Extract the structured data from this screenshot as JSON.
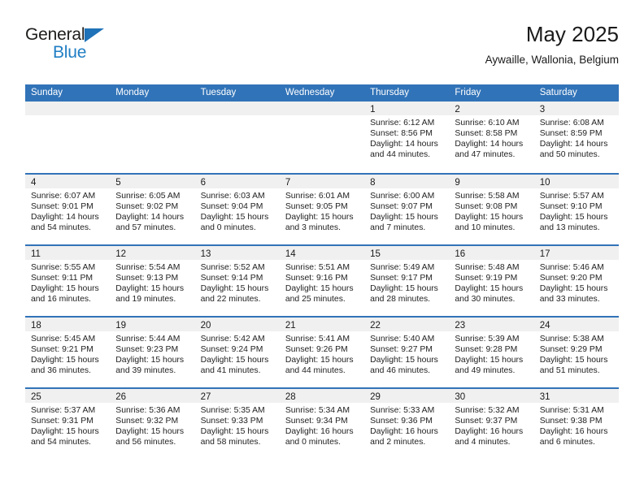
{
  "brand": {
    "name_part1": "General",
    "name_part2": "Blue",
    "triangle_color": "#1f72b8",
    "text_color_part2": "#1f7ec4"
  },
  "header": {
    "title": "May 2025",
    "subtitle": "Aywaille, Wallonia, Belgium"
  },
  "theme": {
    "header_blue": "#3173b8",
    "daystrip_gray": "#f0f0f0",
    "separator_blue": "#3173b8"
  },
  "weekday_headers": [
    "Sunday",
    "Monday",
    "Tuesday",
    "Wednesday",
    "Thursday",
    "Friday",
    "Saturday"
  ],
  "weeks": [
    {
      "days": [
        {
          "date": "",
          "empty": true,
          "sunrise": "",
          "sunset": "",
          "daylight_line1": "",
          "daylight_line2": ""
        },
        {
          "date": "",
          "empty": true,
          "sunrise": "",
          "sunset": "",
          "daylight_line1": "",
          "daylight_line2": ""
        },
        {
          "date": "",
          "empty": true,
          "sunrise": "",
          "sunset": "",
          "daylight_line1": "",
          "daylight_line2": ""
        },
        {
          "date": "",
          "empty": true,
          "sunrise": "",
          "sunset": "",
          "daylight_line1": "",
          "daylight_line2": ""
        },
        {
          "date": "1",
          "empty": false,
          "sunrise": "Sunrise: 6:12 AM",
          "sunset": "Sunset: 8:56 PM",
          "daylight_line1": "Daylight: 14 hours",
          "daylight_line2": "and 44 minutes."
        },
        {
          "date": "2",
          "empty": false,
          "sunrise": "Sunrise: 6:10 AM",
          "sunset": "Sunset: 8:58 PM",
          "daylight_line1": "Daylight: 14 hours",
          "daylight_line2": "and 47 minutes."
        },
        {
          "date": "3",
          "empty": false,
          "sunrise": "Sunrise: 6:08 AM",
          "sunset": "Sunset: 8:59 PM",
          "daylight_line1": "Daylight: 14 hours",
          "daylight_line2": "and 50 minutes."
        }
      ]
    },
    {
      "days": [
        {
          "date": "4",
          "empty": false,
          "sunrise": "Sunrise: 6:07 AM",
          "sunset": "Sunset: 9:01 PM",
          "daylight_line1": "Daylight: 14 hours",
          "daylight_line2": "and 54 minutes."
        },
        {
          "date": "5",
          "empty": false,
          "sunrise": "Sunrise: 6:05 AM",
          "sunset": "Sunset: 9:02 PM",
          "daylight_line1": "Daylight: 14 hours",
          "daylight_line2": "and 57 minutes."
        },
        {
          "date": "6",
          "empty": false,
          "sunrise": "Sunrise: 6:03 AM",
          "sunset": "Sunset: 9:04 PM",
          "daylight_line1": "Daylight: 15 hours",
          "daylight_line2": "and 0 minutes."
        },
        {
          "date": "7",
          "empty": false,
          "sunrise": "Sunrise: 6:01 AM",
          "sunset": "Sunset: 9:05 PM",
          "daylight_line1": "Daylight: 15 hours",
          "daylight_line2": "and 3 minutes."
        },
        {
          "date": "8",
          "empty": false,
          "sunrise": "Sunrise: 6:00 AM",
          "sunset": "Sunset: 9:07 PM",
          "daylight_line1": "Daylight: 15 hours",
          "daylight_line2": "and 7 minutes."
        },
        {
          "date": "9",
          "empty": false,
          "sunrise": "Sunrise: 5:58 AM",
          "sunset": "Sunset: 9:08 PM",
          "daylight_line1": "Daylight: 15 hours",
          "daylight_line2": "and 10 minutes."
        },
        {
          "date": "10",
          "empty": false,
          "sunrise": "Sunrise: 5:57 AM",
          "sunset": "Sunset: 9:10 PM",
          "daylight_line1": "Daylight: 15 hours",
          "daylight_line2": "and 13 minutes."
        }
      ]
    },
    {
      "days": [
        {
          "date": "11",
          "empty": false,
          "sunrise": "Sunrise: 5:55 AM",
          "sunset": "Sunset: 9:11 PM",
          "daylight_line1": "Daylight: 15 hours",
          "daylight_line2": "and 16 minutes."
        },
        {
          "date": "12",
          "empty": false,
          "sunrise": "Sunrise: 5:54 AM",
          "sunset": "Sunset: 9:13 PM",
          "daylight_line1": "Daylight: 15 hours",
          "daylight_line2": "and 19 minutes."
        },
        {
          "date": "13",
          "empty": false,
          "sunrise": "Sunrise: 5:52 AM",
          "sunset": "Sunset: 9:14 PM",
          "daylight_line1": "Daylight: 15 hours",
          "daylight_line2": "and 22 minutes."
        },
        {
          "date": "14",
          "empty": false,
          "sunrise": "Sunrise: 5:51 AM",
          "sunset": "Sunset: 9:16 PM",
          "daylight_line1": "Daylight: 15 hours",
          "daylight_line2": "and 25 minutes."
        },
        {
          "date": "15",
          "empty": false,
          "sunrise": "Sunrise: 5:49 AM",
          "sunset": "Sunset: 9:17 PM",
          "daylight_line1": "Daylight: 15 hours",
          "daylight_line2": "and 28 minutes."
        },
        {
          "date": "16",
          "empty": false,
          "sunrise": "Sunrise: 5:48 AM",
          "sunset": "Sunset: 9:19 PM",
          "daylight_line1": "Daylight: 15 hours",
          "daylight_line2": "and 30 minutes."
        },
        {
          "date": "17",
          "empty": false,
          "sunrise": "Sunrise: 5:46 AM",
          "sunset": "Sunset: 9:20 PM",
          "daylight_line1": "Daylight: 15 hours",
          "daylight_line2": "and 33 minutes."
        }
      ]
    },
    {
      "days": [
        {
          "date": "18",
          "empty": false,
          "sunrise": "Sunrise: 5:45 AM",
          "sunset": "Sunset: 9:21 PM",
          "daylight_line1": "Daylight: 15 hours",
          "daylight_line2": "and 36 minutes."
        },
        {
          "date": "19",
          "empty": false,
          "sunrise": "Sunrise: 5:44 AM",
          "sunset": "Sunset: 9:23 PM",
          "daylight_line1": "Daylight: 15 hours",
          "daylight_line2": "and 39 minutes."
        },
        {
          "date": "20",
          "empty": false,
          "sunrise": "Sunrise: 5:42 AM",
          "sunset": "Sunset: 9:24 PM",
          "daylight_line1": "Daylight: 15 hours",
          "daylight_line2": "and 41 minutes."
        },
        {
          "date": "21",
          "empty": false,
          "sunrise": "Sunrise: 5:41 AM",
          "sunset": "Sunset: 9:26 PM",
          "daylight_line1": "Daylight: 15 hours",
          "daylight_line2": "and 44 minutes."
        },
        {
          "date": "22",
          "empty": false,
          "sunrise": "Sunrise: 5:40 AM",
          "sunset": "Sunset: 9:27 PM",
          "daylight_line1": "Daylight: 15 hours",
          "daylight_line2": "and 46 minutes."
        },
        {
          "date": "23",
          "empty": false,
          "sunrise": "Sunrise: 5:39 AM",
          "sunset": "Sunset: 9:28 PM",
          "daylight_line1": "Daylight: 15 hours",
          "daylight_line2": "and 49 minutes."
        },
        {
          "date": "24",
          "empty": false,
          "sunrise": "Sunrise: 5:38 AM",
          "sunset": "Sunset: 9:29 PM",
          "daylight_line1": "Daylight: 15 hours",
          "daylight_line2": "and 51 minutes."
        }
      ]
    },
    {
      "days": [
        {
          "date": "25",
          "empty": false,
          "sunrise": "Sunrise: 5:37 AM",
          "sunset": "Sunset: 9:31 PM",
          "daylight_line1": "Daylight: 15 hours",
          "daylight_line2": "and 54 minutes."
        },
        {
          "date": "26",
          "empty": false,
          "sunrise": "Sunrise: 5:36 AM",
          "sunset": "Sunset: 9:32 PM",
          "daylight_line1": "Daylight: 15 hours",
          "daylight_line2": "and 56 minutes."
        },
        {
          "date": "27",
          "empty": false,
          "sunrise": "Sunrise: 5:35 AM",
          "sunset": "Sunset: 9:33 PM",
          "daylight_line1": "Daylight: 15 hours",
          "daylight_line2": "and 58 minutes."
        },
        {
          "date": "28",
          "empty": false,
          "sunrise": "Sunrise: 5:34 AM",
          "sunset": "Sunset: 9:34 PM",
          "daylight_line1": "Daylight: 16 hours",
          "daylight_line2": "and 0 minutes."
        },
        {
          "date": "29",
          "empty": false,
          "sunrise": "Sunrise: 5:33 AM",
          "sunset": "Sunset: 9:36 PM",
          "daylight_line1": "Daylight: 16 hours",
          "daylight_line2": "and 2 minutes."
        },
        {
          "date": "30",
          "empty": false,
          "sunrise": "Sunrise: 5:32 AM",
          "sunset": "Sunset: 9:37 PM",
          "daylight_line1": "Daylight: 16 hours",
          "daylight_line2": "and 4 minutes."
        },
        {
          "date": "31",
          "empty": false,
          "sunrise": "Sunrise: 5:31 AM",
          "sunset": "Sunset: 9:38 PM",
          "daylight_line1": "Daylight: 16 hours",
          "daylight_line2": "and 6 minutes."
        }
      ]
    }
  ]
}
